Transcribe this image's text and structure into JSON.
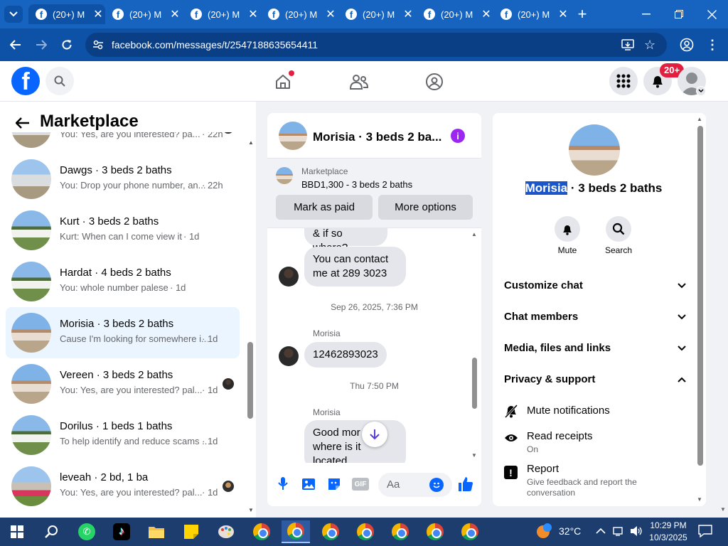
{
  "browser": {
    "tabs": [
      {
        "label": "(20+) M",
        "active": true
      },
      {
        "label": "(20+) M",
        "active": false
      },
      {
        "label": "(20+) M",
        "active": false
      },
      {
        "label": "(20+) M",
        "active": false
      },
      {
        "label": "(20+) M",
        "active": false
      },
      {
        "label": "(20+) M",
        "active": false
      },
      {
        "label": "(20+) M",
        "active": false
      }
    ],
    "url": "facebook.com/messages/t/2547188635654411"
  },
  "header": {
    "notification_badge": "20+",
    "brand_color": "#0866ff"
  },
  "left": {
    "title": "Marketplace",
    "conversations": [
      {
        "name": "",
        "preview": "You: Yes, are you interested? pa...",
        "time": "· 22h",
        "selected": false
      },
      {
        "name": "Dawgs · 3 beds 2 baths",
        "preview": "You: Drop your phone number, an...",
        "time": "· 22h",
        "selected": false
      },
      {
        "name": "Kurt · 3 beds 2 baths",
        "preview": "Kurt: When can I come view it",
        "time": "· 1d",
        "selected": false
      },
      {
        "name": "Hardat · 4 beds 2 baths",
        "preview": "You: whole number palese",
        "time": "· 1d",
        "selected": false
      },
      {
        "name": "Morisia · 3 beds 2 baths",
        "preview": "Cause I'm looking for somewhere i...",
        "time": "· 1d",
        "selected": true
      },
      {
        "name": "Vereen · 3 beds 2 baths",
        "preview": "You: Yes, are you interested? pal...",
        "time": "· 1d",
        "selected": false
      },
      {
        "name": "Dorilus · 1 beds 1 baths",
        "preview": "To help identify and reduce scams ...",
        "time": "· 1d",
        "selected": false
      },
      {
        "name": "leveah · 2 bd, 1 ba",
        "preview": "You: Yes, are you interested? pal...",
        "time": "· 1d",
        "selected": false
      }
    ]
  },
  "chat": {
    "title": "Morisia · 3 beds 2 ba...",
    "listing_label": "Marketplace",
    "listing_detail": "BBD1,300 - 3 beds 2 baths",
    "mark_paid": "Mark as paid",
    "more_options": "More options",
    "msg_partial": "& if so where?",
    "msg_contact_1": "You can contact",
    "msg_contact_2": "me at 289 3023",
    "ts1": "Sep 26, 2025, 7:36 PM",
    "sender1": "Morisia",
    "msg_number": "12462893023",
    "ts2": "Thu 7:50 PM",
    "sender2": "Morisia",
    "msg_last_1": "Good mor",
    "msg_last_2": "where is it",
    "msg_last_3": "located",
    "input_placeholder": "Aa"
  },
  "info": {
    "name_highlight": "Morisia",
    "name_rest": " · 3 beds 2 baths",
    "mute_label": "Mute",
    "search_label": "Search",
    "sections": [
      "Customize chat",
      "Chat members",
      "Media, files and links",
      "Privacy & support"
    ],
    "mute_notifications": "Mute notifications",
    "read_receipts": "Read receipts",
    "read_receipts_state": "On",
    "report": "Report",
    "report_desc_1": "Give feedback and report the",
    "report_desc_2": "conversation"
  },
  "taskbar": {
    "temperature": "32°C",
    "time": "10:29 PM",
    "date": "10/3/2025"
  }
}
